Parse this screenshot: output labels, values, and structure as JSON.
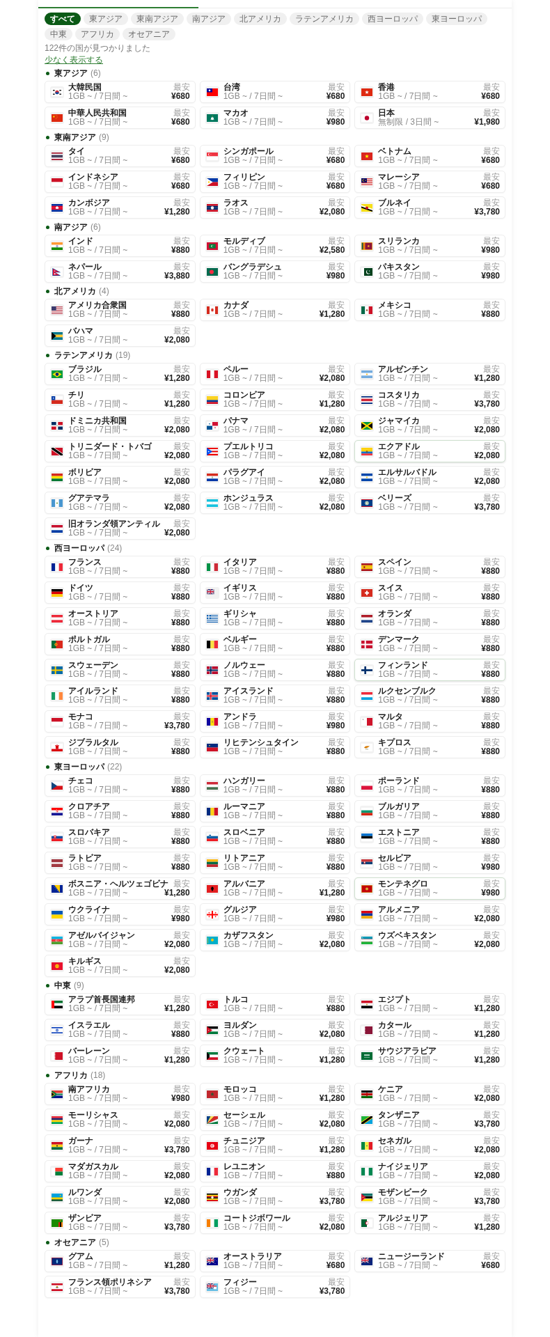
{
  "filters": [
    {
      "label": "すべて",
      "selected": true
    },
    {
      "label": "東アジア",
      "selected": false
    },
    {
      "label": "東南アジア",
      "selected": false
    },
    {
      "label": "南アジア",
      "selected": false
    },
    {
      "label": "北アメリカ",
      "selected": false
    },
    {
      "label": "ラテンアメリカ",
      "selected": false
    },
    {
      "label": "西ヨーロッパ",
      "selected": false
    },
    {
      "label": "東ヨーロッパ",
      "selected": false
    },
    {
      "label": "中東",
      "selected": false
    },
    {
      "label": "アフリカ",
      "selected": false
    },
    {
      "label": "オセアニア",
      "selected": false
    }
  ],
  "result_count": "122件の国が見つかりました",
  "toggle_link": "少なく表示する",
  "sections": [
    {
      "title": "東アジア",
      "count": "(6)",
      "countries": [
        {
          "name": "大韓民国",
          "plan": "1GB ~ / 7日間 ~",
          "label": "最安",
          "price": "¥680",
          "highlighted": false
        },
        {
          "name": "台湾",
          "plan": "1GB ~ / 7日間 ~",
          "label": "最安",
          "price": "¥680",
          "highlighted": false
        },
        {
          "name": "香港",
          "plan": "1GB ~ / 7日間 ~",
          "label": "最安",
          "price": "¥680",
          "highlighted": false
        },
        {
          "name": "中華人民共和国",
          "plan": "1GB ~ / 7日間 ~",
          "label": "最安",
          "price": "¥680",
          "highlighted": false
        },
        {
          "name": "マカオ",
          "plan": "1GB ~ / 7日間 ~",
          "label": "最安",
          "price": "¥980",
          "highlighted": false
        },
        {
          "name": "日本",
          "plan": "無制限 / 3日間 ~",
          "label": "最安",
          "price": "¥1,980",
          "highlighted": false
        }
      ]
    },
    {
      "title": "東南アジア",
      "count": "(9)",
      "countries": [
        {
          "name": "タイ",
          "plan": "1GB ~ / 7日間 ~",
          "label": "最安",
          "price": "¥680",
          "highlighted": false
        },
        {
          "name": "シンガポール",
          "plan": "1GB ~ / 7日間 ~",
          "label": "最安",
          "price": "¥680",
          "highlighted": false
        },
        {
          "name": "ベトナム",
          "plan": "1GB ~ / 7日間 ~",
          "label": "最安",
          "price": "¥680",
          "highlighted": false
        },
        {
          "name": "インドネシア",
          "plan": "1GB ~ / 7日間 ~",
          "label": "最安",
          "price": "¥680",
          "highlighted": false
        },
        {
          "name": "フィリピン",
          "plan": "1GB ~ / 7日間 ~",
          "label": "最安",
          "price": "¥680",
          "highlighted": false
        },
        {
          "name": "マレーシア",
          "plan": "1GB ~ / 7日間 ~",
          "label": "最安",
          "price": "¥680",
          "highlighted": false
        },
        {
          "name": "カンボジア",
          "plan": "1GB ~ / 7日間 ~",
          "label": "最安",
          "price": "¥1,280",
          "highlighted": false
        },
        {
          "name": "ラオス",
          "plan": "1GB ~ / 7日間 ~",
          "label": "最安",
          "price": "¥2,080",
          "highlighted": false
        },
        {
          "name": "ブルネイ",
          "plan": "1GB ~ / 7日間 ~",
          "label": "最安",
          "price": "¥3,780",
          "highlighted": false
        }
      ]
    },
    {
      "title": "南アジア",
      "count": "(6)",
      "countries": [
        {
          "name": "インド",
          "plan": "1GB ~ / 7日間 ~",
          "label": "最安",
          "price": "¥880",
          "highlighted": false
        },
        {
          "name": "モルディブ",
          "plan": "1GB ~ / 7日間 ~",
          "label": "最安",
          "price": "¥2,580",
          "highlighted": false
        },
        {
          "name": "スリランカ",
          "plan": "1GB ~ / 7日間 ~",
          "label": "最安",
          "price": "¥980",
          "highlighted": false
        },
        {
          "name": "ネパール",
          "plan": "1GB ~ / 7日間 ~",
          "label": "最安",
          "price": "¥3,880",
          "highlighted": false
        },
        {
          "name": "バングラデシュ",
          "plan": "1GB ~ / 7日間 ~",
          "label": "最安",
          "price": "¥980",
          "highlighted": false
        },
        {
          "name": "パキスタン",
          "plan": "1GB ~ / 7日間 ~",
          "label": "最安",
          "price": "¥980",
          "highlighted": false
        }
      ]
    },
    {
      "title": "北アメリカ",
      "count": "(4)",
      "countries": [
        {
          "name": "アメリカ合衆国",
          "plan": "1GB ~ / 7日間 ~",
          "label": "最安",
          "price": "¥880",
          "highlighted": false
        },
        {
          "name": "カナダ",
          "plan": "1GB ~ / 7日間 ~",
          "label": "最安",
          "price": "¥1,280",
          "highlighted": false
        },
        {
          "name": "メキシコ",
          "plan": "1GB ~ / 7日間 ~",
          "label": "最安",
          "price": "¥880",
          "highlighted": false
        },
        {
          "name": "バハマ",
          "plan": "1GB ~ / 7日間 ~",
          "label": "最安",
          "price": "¥2,080",
          "highlighted": false
        }
      ]
    },
    {
      "title": "ラテンアメリカ",
      "count": "(19)",
      "countries": [
        {
          "name": "ブラジル",
          "plan": "1GB ~ / 7日間 ~",
          "label": "最安",
          "price": "¥1,280",
          "highlighted": false
        },
        {
          "name": "ペルー",
          "plan": "1GB ~ / 7日間 ~",
          "label": "最安",
          "price": "¥2,080",
          "highlighted": false
        },
        {
          "name": "アルゼンチン",
          "plan": "1GB ~ / 7日間 ~",
          "label": "最安",
          "price": "¥1,280",
          "highlighted": false
        },
        {
          "name": "チリ",
          "plan": "1GB ~ / 7日間 ~",
          "label": "最安",
          "price": "¥1,280",
          "highlighted": false
        },
        {
          "name": "コロンビア",
          "plan": "1GB ~ / 7日間 ~",
          "label": "最安",
          "price": "¥1,280",
          "highlighted": false
        },
        {
          "name": "コスタリカ",
          "plan": "1GB ~ / 7日間 ~",
          "label": "最安",
          "price": "¥3,780",
          "highlighted": false
        },
        {
          "name": "ドミニカ共和国",
          "plan": "1GB ~ / 7日間 ~",
          "label": "最安",
          "price": "¥2,080",
          "highlighted": false
        },
        {
          "name": "パナマ",
          "plan": "1GB ~ / 7日間 ~",
          "label": "最安",
          "price": "¥2,080",
          "highlighted": false
        },
        {
          "name": "ジャマイカ",
          "plan": "1GB ~ / 7日間 ~",
          "label": "最安",
          "price": "¥2,080",
          "highlighted": false
        },
        {
          "name": "トリニダード・トバゴ",
          "plan": "1GB ~ / 7日間 ~",
          "label": "最安",
          "price": "¥2,080",
          "highlighted": false
        },
        {
          "name": "プエルトリコ",
          "plan": "1GB ~ / 7日間 ~",
          "label": "最安",
          "price": "¥2,080",
          "highlighted": false
        },
        {
          "name": "エクアドル",
          "plan": "1GB ~ / 7日間 ~",
          "label": "最安",
          "price": "¥2,080",
          "highlighted": true
        },
        {
          "name": "ボリビア",
          "plan": "1GB ~ / 7日間 ~",
          "label": "最安",
          "price": "¥2,080",
          "highlighted": false
        },
        {
          "name": "パラグアイ",
          "plan": "1GB ~ / 7日間 ~",
          "label": "最安",
          "price": "¥2,080",
          "highlighted": false
        },
        {
          "name": "エルサルバドル",
          "plan": "1GB ~ / 7日間 ~",
          "label": "最安",
          "price": "¥2,080",
          "highlighted": false
        },
        {
          "name": "グアテマラ",
          "plan": "1GB ~ / 7日間 ~",
          "label": "最安",
          "price": "¥2,080",
          "highlighted": false
        },
        {
          "name": "ホンジュラス",
          "plan": "1GB ~ / 7日間 ~",
          "label": "最安",
          "price": "¥2,080",
          "highlighted": false
        },
        {
          "name": "ベリーズ",
          "plan": "1GB ~ / 7日間 ~",
          "label": "最安",
          "price": "¥3,780",
          "highlighted": false
        },
        {
          "name": "旧オランダ領アンティル",
          "plan": "1GB ~ / 7日間 ~",
          "label": "最安",
          "price": "¥2,080",
          "highlighted": false
        }
      ]
    },
    {
      "title": "西ヨーロッパ",
      "count": "(24)",
      "countries": [
        {
          "name": "フランス",
          "plan": "1GB ~ / 7日間 ~",
          "label": "最安",
          "price": "¥880",
          "highlighted": false
        },
        {
          "name": "イタリア",
          "plan": "1GB ~ / 7日間 ~",
          "label": "最安",
          "price": "¥880",
          "highlighted": false
        },
        {
          "name": "スペイン",
          "plan": "1GB ~ / 7日間 ~",
          "label": "最安",
          "price": "¥880",
          "highlighted": false
        },
        {
          "name": "ドイツ",
          "plan": "1GB ~ / 7日間 ~",
          "label": "最安",
          "price": "¥880",
          "highlighted": false
        },
        {
          "name": "イギリス",
          "plan": "1GB ~ / 7日間 ~",
          "label": "最安",
          "price": "¥880",
          "highlighted": false
        },
        {
          "name": "スイス",
          "plan": "1GB ~ / 7日間 ~",
          "label": "最安",
          "price": "¥880",
          "highlighted": false
        },
        {
          "name": "オーストリア",
          "plan": "1GB ~ / 7日間 ~",
          "label": "最安",
          "price": "¥880",
          "highlighted": false
        },
        {
          "name": "ギリシャ",
          "plan": "1GB ~ / 7日間 ~",
          "label": "最安",
          "price": "¥880",
          "highlighted": false
        },
        {
          "name": "オランダ",
          "plan": "1GB ~ / 7日間 ~",
          "label": "最安",
          "price": "¥880",
          "highlighted": false
        },
        {
          "name": "ポルトガル",
          "plan": "1GB ~ / 7日間 ~",
          "label": "最安",
          "price": "¥880",
          "highlighted": false
        },
        {
          "name": "ベルギー",
          "plan": "1GB ~ / 7日間 ~",
          "label": "最安",
          "price": "¥880",
          "highlighted": false
        },
        {
          "name": "デンマーク",
          "plan": "1GB ~ / 7日間 ~",
          "label": "最安",
          "price": "¥880",
          "highlighted": false
        },
        {
          "name": "スウェーデン",
          "plan": "1GB ~ / 7日間 ~",
          "label": "最安",
          "price": "¥880",
          "highlighted": false
        },
        {
          "name": "ノルウェー",
          "plan": "1GB ~ / 7日間 ~",
          "label": "最安",
          "price": "¥880",
          "highlighted": false
        },
        {
          "name": "フィンランド",
          "plan": "1GB ~ / 7日間 ~",
          "label": "最安",
          "price": "¥880",
          "highlighted": true
        },
        {
          "name": "アイルランド",
          "plan": "1GB ~ / 7日間 ~",
          "label": "最安",
          "price": "¥880",
          "highlighted": false
        },
        {
          "name": "アイスランド",
          "plan": "1GB ~ / 7日間 ~",
          "label": "最安",
          "price": "¥880",
          "highlighted": false
        },
        {
          "name": "ルクセンブルク",
          "plan": "1GB ~ / 7日間 ~",
          "label": "最安",
          "price": "¥880",
          "highlighted": false
        },
        {
          "name": "モナコ",
          "plan": "1GB ~ / 7日間 ~",
          "label": "最安",
          "price": "¥3,780",
          "highlighted": false
        },
        {
          "name": "アンドラ",
          "plan": "1GB ~ / 7日間 ~",
          "label": "最安",
          "price": "¥980",
          "highlighted": false
        },
        {
          "name": "マルタ",
          "plan": "1GB ~ / 7日間 ~",
          "label": "最安",
          "price": "¥880",
          "highlighted": false
        },
        {
          "name": "ジブラルタル",
          "plan": "1GB ~ / 7日間 ~",
          "label": "最安",
          "price": "¥880",
          "highlighted": false
        },
        {
          "name": "リヒテンシュタイン",
          "plan": "1GB ~ / 7日間 ~",
          "label": "最安",
          "price": "¥880",
          "highlighted": false
        },
        {
          "name": "キプロス",
          "plan": "1GB ~ / 7日間 ~",
          "label": "最安",
          "price": "¥880",
          "highlighted": false
        }
      ]
    },
    {
      "title": "東ヨーロッパ",
      "count": "(22)",
      "countries": [
        {
          "name": "チェコ",
          "plan": "1GB ~ / 7日間 ~",
          "label": "最安",
          "price": "¥880",
          "highlighted": false
        },
        {
          "name": "ハンガリー",
          "plan": "1GB ~ / 7日間 ~",
          "label": "最安",
          "price": "¥880",
          "highlighted": false
        },
        {
          "name": "ポーランド",
          "plan": "1GB ~ / 7日間 ~",
          "label": "最安",
          "price": "¥880",
          "highlighted": false
        },
        {
          "name": "クロアチア",
          "plan": "1GB ~ / 7日間 ~",
          "label": "最安",
          "price": "¥880",
          "highlighted": false
        },
        {
          "name": "ルーマニア",
          "plan": "1GB ~ / 7日間 ~",
          "label": "最安",
          "price": "¥880",
          "highlighted": false
        },
        {
          "name": "ブルガリア",
          "plan": "1GB ~ / 7日間 ~",
          "label": "最安",
          "price": "¥880",
          "highlighted": false
        },
        {
          "name": "スロバキア",
          "plan": "1GB ~ / 7日間 ~",
          "label": "最安",
          "price": "¥880",
          "highlighted": false
        },
        {
          "name": "スロベニア",
          "plan": "1GB ~ / 7日間 ~",
          "label": "最安",
          "price": "¥880",
          "highlighted": false
        },
        {
          "name": "エストニア",
          "plan": "1GB ~ / 7日間 ~",
          "label": "最安",
          "price": "¥880",
          "highlighted": false
        },
        {
          "name": "ラトビア",
          "plan": "1GB ~ / 7日間 ~",
          "label": "最安",
          "price": "¥880",
          "highlighted": false
        },
        {
          "name": "リトアニア",
          "plan": "1GB ~ / 7日間 ~",
          "label": "最安",
          "price": "¥880",
          "highlighted": false
        },
        {
          "name": "セルビア",
          "plan": "1GB ~ / 7日間 ~",
          "label": "最安",
          "price": "¥980",
          "highlighted": false
        },
        {
          "name": "ボスニア・ヘルツェゴビナ",
          "plan": "1GB ~ / 7日間 ~",
          "label": "最安",
          "price": "¥1,280",
          "highlighted": false
        },
        {
          "name": "アルバニア",
          "plan": "1GB ~ / 7日間 ~",
          "label": "最安",
          "price": "¥1,280",
          "highlighted": false
        },
        {
          "name": "モンテネグロ",
          "plan": "1GB ~ / 7日間 ~",
          "label": "最安",
          "price": "¥980",
          "highlighted": true
        },
        {
          "name": "ウクライナ",
          "plan": "1GB ~ / 7日間 ~",
          "label": "最安",
          "price": "¥980",
          "highlighted": false
        },
        {
          "name": "グルジア",
          "plan": "1GB ~ / 7日間 ~",
          "label": "最安",
          "price": "¥980",
          "highlighted": false
        },
        {
          "name": "アルメニア",
          "plan": "1GB ~ / 7日間 ~",
          "label": "最安",
          "price": "¥2,080",
          "highlighted": false
        },
        {
          "name": "アゼルバイジャン",
          "plan": "1GB ~ / 7日間 ~",
          "label": "最安",
          "price": "¥2,080",
          "highlighted": false
        },
        {
          "name": "カザフスタン",
          "plan": "1GB ~ / 7日間 ~",
          "label": "最安",
          "price": "¥2,080",
          "highlighted": false
        },
        {
          "name": "ウズベキスタン",
          "plan": "1GB ~ / 7日間 ~",
          "label": "最安",
          "price": "¥2,080",
          "highlighted": false
        },
        {
          "name": "キルギス",
          "plan": "1GB ~ / 7日間 ~",
          "label": "最安",
          "price": "¥2,080",
          "highlighted": false
        }
      ]
    },
    {
      "title": "中東",
      "count": "(9)",
      "countries": [
        {
          "name": "アラブ首長国連邦",
          "plan": "1GB ~ / 7日間 ~",
          "label": "最安",
          "price": "¥1,280",
          "highlighted": false
        },
        {
          "name": "トルコ",
          "plan": "1GB ~ / 7日間 ~",
          "label": "最安",
          "price": "¥880",
          "highlighted": false
        },
        {
          "name": "エジプト",
          "plan": "1GB ~ / 7日間 ~",
          "label": "最安",
          "price": "¥1,280",
          "highlighted": false
        },
        {
          "name": "イスラエル",
          "plan": "1GB ~ / 7日間 ~",
          "label": "最安",
          "price": "¥880",
          "highlighted": false
        },
        {
          "name": "ヨルダン",
          "plan": "1GB ~ / 7日間 ~",
          "label": "最安",
          "price": "¥2,080",
          "highlighted": false
        },
        {
          "name": "カタール",
          "plan": "1GB ~ / 7日間 ~",
          "label": "最安",
          "price": "¥1,280",
          "highlighted": false
        },
        {
          "name": "バーレーン",
          "plan": "1GB ~ / 7日間 ~",
          "label": "最安",
          "price": "¥1,280",
          "highlighted": false
        },
        {
          "name": "クウェート",
          "plan": "1GB ~ / 7日間 ~",
          "label": "最安",
          "price": "¥1,280",
          "highlighted": false
        },
        {
          "name": "サウジアラビア",
          "plan": "1GB ~ / 7日間 ~",
          "label": "最安",
          "price": "¥1,280",
          "highlighted": false
        }
      ]
    },
    {
      "title": "アフリカ",
      "count": "(18)",
      "countries": [
        {
          "name": "南アフリカ",
          "plan": "1GB ~ / 7日間 ~",
          "label": "最安",
          "price": "¥980",
          "highlighted": false
        },
        {
          "name": "モロッコ",
          "plan": "1GB ~ / 7日間 ~",
          "label": "最安",
          "price": "¥1,280",
          "highlighted": false
        },
        {
          "name": "ケニア",
          "plan": "1GB ~ / 7日間 ~",
          "label": "最安",
          "price": "¥2,080",
          "highlighted": false
        },
        {
          "name": "モーリシャス",
          "plan": "1GB ~ / 7日間 ~",
          "label": "最安",
          "price": "¥2,080",
          "highlighted": false
        },
        {
          "name": "セーシェル",
          "plan": "1GB ~ / 7日間 ~",
          "label": "最安",
          "price": "¥2,080",
          "highlighted": false
        },
        {
          "name": "タンザニア",
          "plan": "1GB ~ / 7日間 ~",
          "label": "最安",
          "price": "¥3,780",
          "highlighted": false
        },
        {
          "name": "ガーナ",
          "plan": "1GB ~ / 7日間 ~",
          "label": "最安",
          "price": "¥3,780",
          "highlighted": false
        },
        {
          "name": "チュニジア",
          "plan": "1GB ~ / 7日間 ~",
          "label": "最安",
          "price": "¥1,280",
          "highlighted": false
        },
        {
          "name": "セネガル",
          "plan": "1GB ~ / 7日間 ~",
          "label": "最安",
          "price": "¥2,080",
          "highlighted": false
        },
        {
          "name": "マダガスカル",
          "plan": "1GB ~ / 7日間 ~",
          "label": "最安",
          "price": "¥2,080",
          "highlighted": false
        },
        {
          "name": "レユニオン",
          "plan": "1GB ~ / 7日間 ~",
          "label": "最安",
          "price": "¥880",
          "highlighted": false
        },
        {
          "name": "ナイジェリア",
          "plan": "1GB ~ / 7日間 ~",
          "label": "最安",
          "price": "¥2,080",
          "highlighted": false
        },
        {
          "name": "ルワンダ",
          "plan": "1GB ~ / 7日間 ~",
          "label": "最安",
          "price": "¥2,080",
          "highlighted": false
        },
        {
          "name": "ウガンダ",
          "plan": "1GB ~ / 7日間 ~",
          "label": "最安",
          "price": "¥3,780",
          "highlighted": false
        },
        {
          "name": "モザンビーク",
          "plan": "1GB ~ / 7日間 ~",
          "label": "最安",
          "price": "¥3,780",
          "highlighted": false
        },
        {
          "name": "ザンビア",
          "plan": "1GB ~ / 7日間 ~",
          "label": "最安",
          "price": "¥3,780",
          "highlighted": false
        },
        {
          "name": "コートジボワール",
          "plan": "1GB ~ / 7日間 ~",
          "label": "最安",
          "price": "¥2,080",
          "highlighted": false
        },
        {
          "name": "アルジェリア",
          "plan": "1GB ~ / 7日間 ~",
          "label": "最安",
          "price": "¥1,280",
          "highlighted": false
        }
      ]
    },
    {
      "title": "オセアニア",
      "count": "(5)",
      "countries": [
        {
          "name": "グアム",
          "plan": "1GB ~ / 7日間 ~",
          "label": "最安",
          "price": "¥1,280",
          "highlighted": false
        },
        {
          "name": "オーストラリア",
          "plan": "1GB ~ / 7日間 ~",
          "label": "最安",
          "price": "¥680",
          "highlighted": false
        },
        {
          "name": "ニュージーランド",
          "plan": "1GB ~ / 7日間 ~",
          "label": "最安",
          "price": "¥680",
          "highlighted": false
        },
        {
          "name": "フランス領ポリネシア",
          "plan": "1GB ~ / 7日間 ~",
          "label": "最安",
          "price": "¥3,780",
          "highlighted": false
        },
        {
          "name": "フィジー",
          "plan": "1GB ~ / 7日間 ~",
          "label": "最安",
          "price": "¥3,780",
          "highlighted": false
        }
      ]
    }
  ]
}
